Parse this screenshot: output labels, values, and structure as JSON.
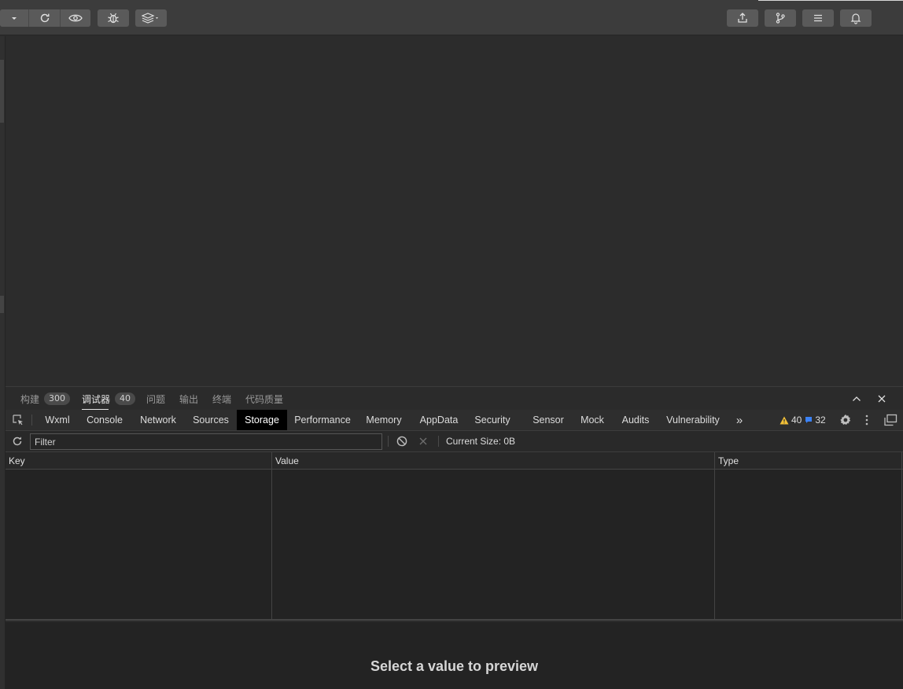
{
  "toolbar": {
    "left_groups": [
      {
        "icon": "dropdown-arrow-icon"
      },
      {
        "icon": "refresh-icon"
      },
      {
        "icon": "preview-eye-icon"
      }
    ],
    "debug_icon": "bug-icon",
    "layers_icon": "layers-icon",
    "right_buttons": [
      {
        "icon": "upload-icon"
      },
      {
        "icon": "branch-icon"
      },
      {
        "icon": "menu-icon"
      },
      {
        "icon": "bell-icon"
      }
    ]
  },
  "panel_tabs": [
    {
      "label": "构建",
      "badge": "300"
    },
    {
      "label": "调试器",
      "badge": "40"
    },
    {
      "label": "问题",
      "badge": ""
    },
    {
      "label": "输出",
      "badge": ""
    },
    {
      "label": "终端",
      "badge": ""
    },
    {
      "label": "代码质量",
      "badge": ""
    }
  ],
  "active_panel_tab": "调试器",
  "devtools_tabs": [
    "Wxml",
    "Console",
    "Network",
    "Sources",
    "Storage",
    "Performance",
    "Memory",
    "AppData",
    "Security",
    "Sensor",
    "Mock",
    "Audits",
    "Vulnerability"
  ],
  "active_devtools_tab": "Storage",
  "more_tabs": "»",
  "counts": {
    "warnings": "40",
    "messages": "32",
    "warning_color": "#f2c037",
    "message_color": "#3b82f6"
  },
  "storage": {
    "filter_placeholder": "Filter",
    "current_size": "Current Size: 0B",
    "columns": [
      "Key",
      "Value",
      "Type"
    ],
    "preview_text": "Select a value to preview"
  },
  "colors": {
    "toolbar_bg": "#3c3c3c",
    "button_bg": "#5a5a5a",
    "active_tab_bg": "#000000",
    "panel_bg": "#232323"
  }
}
